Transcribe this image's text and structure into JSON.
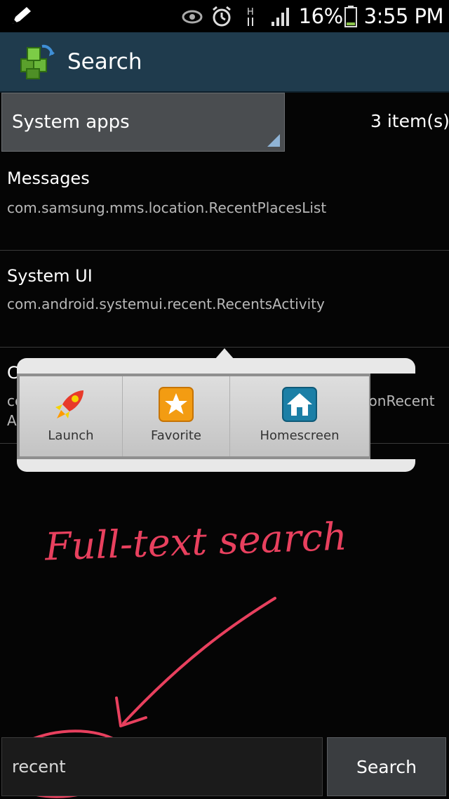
{
  "status_bar": {
    "battery_text": "16%",
    "time": "3:55 PM",
    "icons": [
      "pencil-icon",
      "eye-icon",
      "alarm-icon",
      "hplus-icon",
      "signal-icon",
      "battery-icon"
    ]
  },
  "action_bar": {
    "title": "Search"
  },
  "filter": {
    "selected": "System apps",
    "count_text": "3 item(s)"
  },
  "results": [
    {
      "title": "Messages",
      "subtitle": "com.samsung.mms.location.RecentPlacesList"
    },
    {
      "title": "System UI",
      "subtitle": "com.android.systemui.recent.RecentsActivity"
    },
    {
      "title": "C",
      "subtitle_left": "co",
      "subtitle_right": "ionRecent",
      "subtitle_line2": "A"
    }
  ],
  "popup": {
    "items": [
      {
        "label": "Launch",
        "icon": "rocket-icon"
      },
      {
        "label": "Favorite",
        "icon": "star-icon"
      },
      {
        "label": "Homescreen",
        "icon": "home-icon"
      }
    ]
  },
  "annotation": {
    "text": "Full-text search",
    "color": "#e8405e"
  },
  "search": {
    "value": "recent",
    "button_label": "Search"
  },
  "colors": {
    "action_bar": "#1f3b4d",
    "background": "#050505",
    "accent": "#8fb4d6"
  }
}
